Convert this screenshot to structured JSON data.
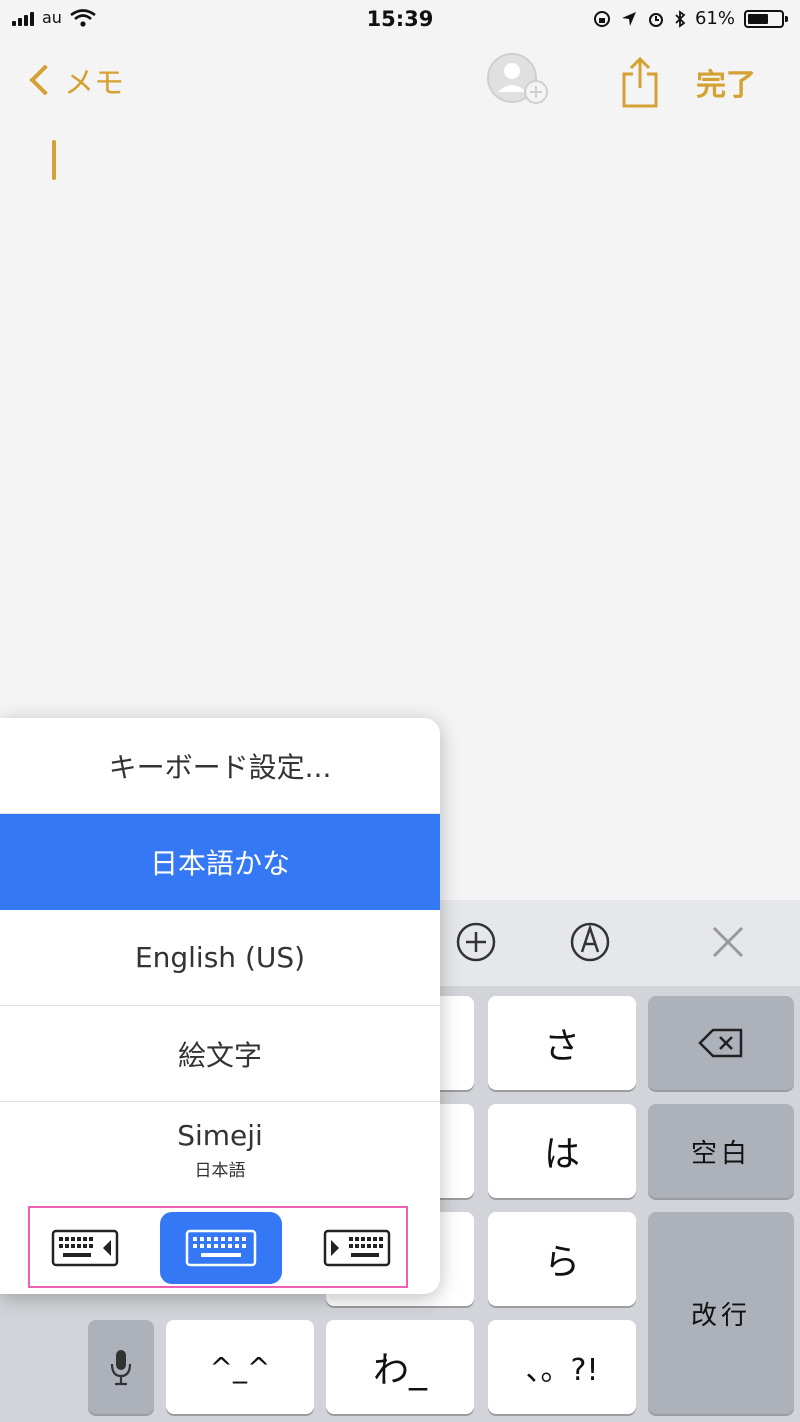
{
  "status_bar": {
    "carrier": "au",
    "time": "15:39",
    "battery": "61%",
    "battery_level": 0.61
  },
  "nav": {
    "back_label": "メモ",
    "done_label": "完了"
  },
  "keyboard": {
    "keys": {
      "sa": "さ",
      "ha": "は",
      "ra": "ら",
      "wa": "わ_",
      "emoticon": "^_^",
      "punct": "、。?!",
      "space": "空白",
      "return": "改行"
    }
  },
  "keyboard_menu": {
    "settings_label": "キーボード設定...",
    "items": [
      {
        "label": "日本語かな",
        "selected": true
      },
      {
        "label": "English (US)",
        "selected": false
      },
      {
        "label": "絵文字",
        "selected": false
      },
      {
        "label": "Simeji",
        "sublabel": "日本語",
        "selected": false
      }
    ],
    "layout_selected": "full"
  },
  "colors": {
    "accent": "#d4a132",
    "selection": "#3478f6",
    "highlight_box": "#ec5fb4"
  }
}
